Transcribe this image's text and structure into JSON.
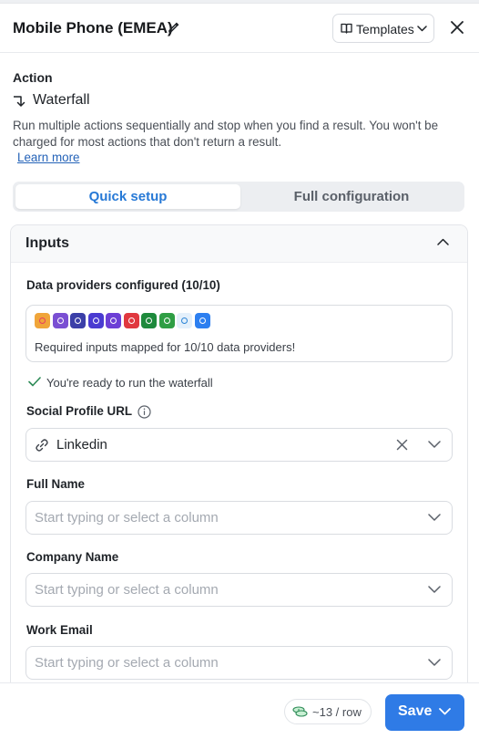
{
  "header": {
    "title": "Mobile Phone (EMEA)",
    "templates_label": "Templates"
  },
  "action": {
    "label": "Action",
    "name": "Waterfall",
    "description": "Run multiple actions sequentially and stop when you find a result. You won't be charged for most actions that don't return a result.",
    "learn_more": "Learn more"
  },
  "tabs": [
    {
      "label": "Quick setup",
      "active": true
    },
    {
      "label": "Full configuration",
      "active": false
    }
  ],
  "inputs": {
    "title": "Inputs",
    "providers_label": "Data providers configured (10/10)",
    "providers_status": "Required inputs mapped for 10/10 data providers!",
    "provider_icons": [
      {
        "name": "provider-icon-1",
        "color": "#f0a53a",
        "accent": "#e63e62"
      },
      {
        "name": "provider-icon-2",
        "color": "#7a4fd3",
        "accent": "#ffffff"
      },
      {
        "name": "provider-icon-3",
        "color": "#3b3fa8",
        "accent": "#ffffff"
      },
      {
        "name": "provider-icon-4",
        "color": "#4a3bd1",
        "accent": "#ffffff"
      },
      {
        "name": "provider-icon-5",
        "color": "#6d3fd6",
        "accent": "#ffffff"
      },
      {
        "name": "provider-icon-6",
        "color": "#e0383f",
        "accent": "#ffffff"
      },
      {
        "name": "provider-icon-7",
        "color": "#1e8a3c",
        "accent": "#ffffff"
      },
      {
        "name": "provider-icon-8",
        "color": "#2f9e44",
        "accent": "#ffffff"
      },
      {
        "name": "provider-icon-9",
        "color": "#e4f0fb",
        "accent": "#2b84d6"
      },
      {
        "name": "provider-icon-10",
        "color": "#2d7ff0",
        "accent": "#ffffff"
      }
    ],
    "ready_text": "You're ready to run the waterfall",
    "fields": [
      {
        "label": "Social Profile URL",
        "value": "Linkedin",
        "placeholder": ""
      },
      {
        "label": "Full Name",
        "value": "",
        "placeholder": "Start typing or select a column"
      },
      {
        "label": "Company Name",
        "value": "",
        "placeholder": "Start typing or select a column"
      },
      {
        "label": "Work Email",
        "value": "",
        "placeholder": "Start typing or select a column"
      }
    ]
  },
  "footer": {
    "credits": "~13 / row",
    "save_label": "Save"
  },
  "colors": {
    "accent": "#2f7be6",
    "active_tab_text": "#2779d6",
    "ready_check": "#2e8b57"
  }
}
